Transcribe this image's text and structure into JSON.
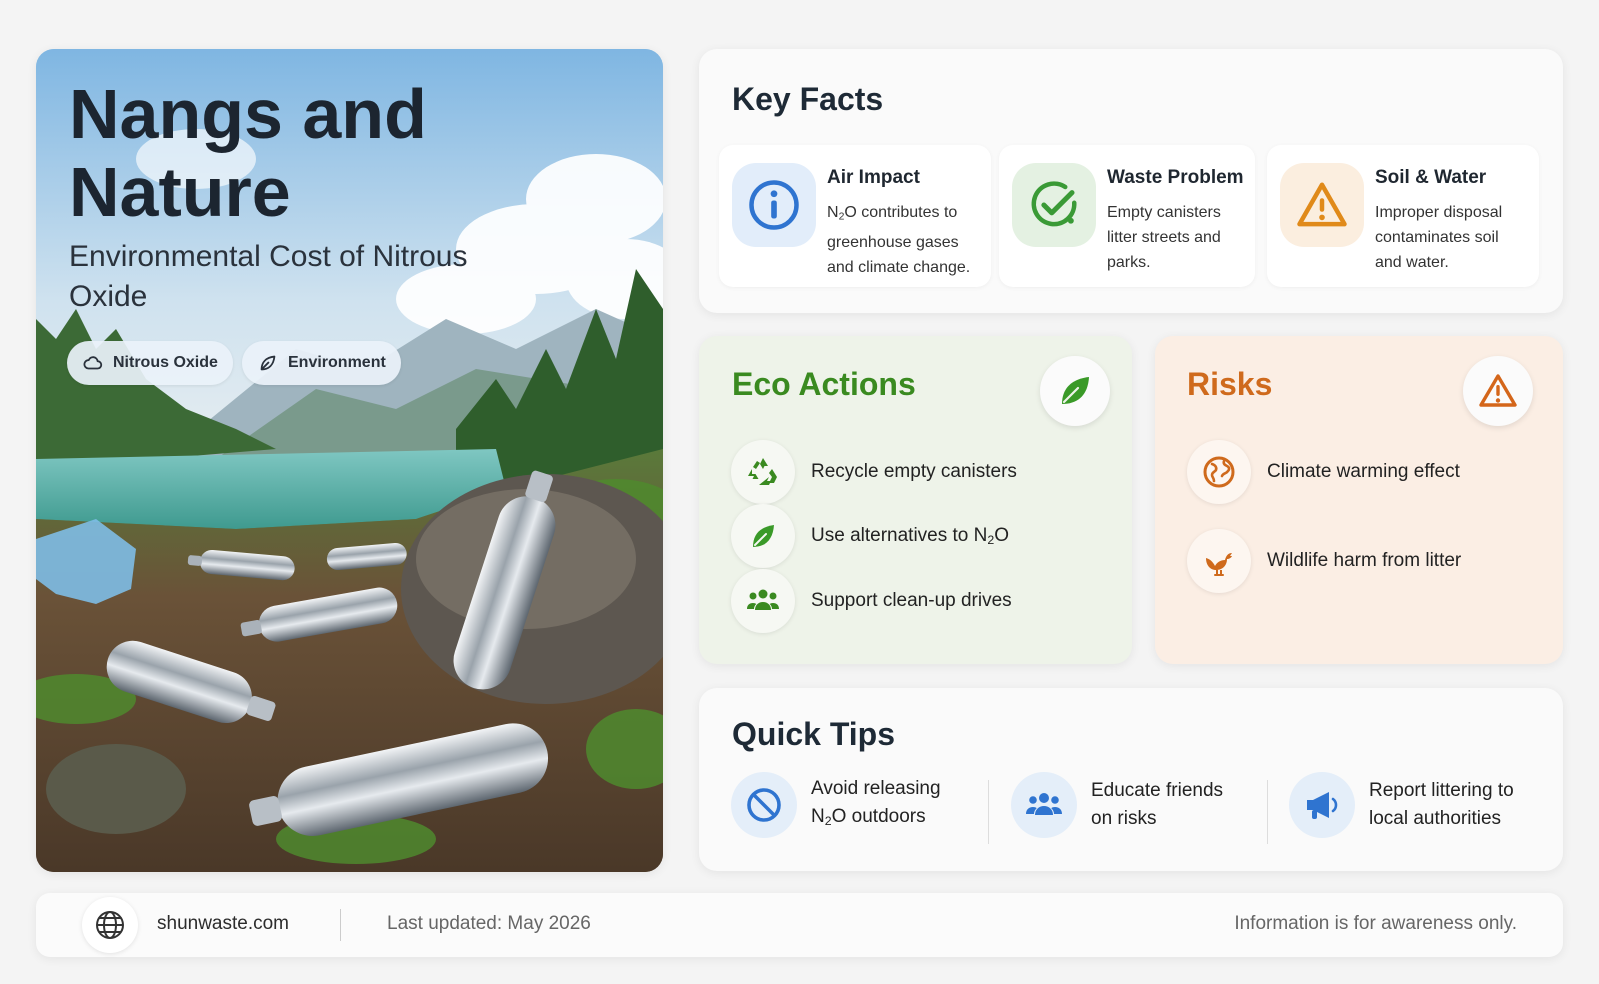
{
  "hero": {
    "title": "Nangs and Nature",
    "subtitle": "Environmental Cost of Nitrous Oxide",
    "tags": [
      {
        "label": "Nitrous Oxide",
        "icon": "cloud-icon"
      },
      {
        "label": "Environment",
        "icon": "leaf-icon"
      }
    ],
    "image": "lakeside-canisters-photo"
  },
  "key_facts": {
    "title": "Key Facts",
    "items": [
      {
        "title": "Air Impact",
        "text_pre": "N",
        "text_sub": "2",
        "text_post": "O contributes to greenhouse gases and climate change.",
        "icon": "info-icon",
        "color": "#2f74d0"
      },
      {
        "title": "Waste Problem",
        "text": "Empty canisters litter streets and parks.",
        "icon": "check-circle-icon",
        "color": "#3a9a36"
      },
      {
        "title": "Soil & Water",
        "text": "Improper disposal contaminates soil and water.",
        "icon": "warning-icon",
        "color": "#e08a1a"
      }
    ]
  },
  "eco_actions": {
    "title": "Eco Actions",
    "badge_icon": "leaf-icon",
    "color": "#3a8a20",
    "items": [
      {
        "text": "Recycle empty canisters",
        "icon": "recycle-icon"
      },
      {
        "text_pre": "Use alternatives to N",
        "text_sub": "2",
        "text_post": "O",
        "icon": "leaf-icon"
      },
      {
        "text": "Support clean-up drives",
        "icon": "people-icon"
      }
    ]
  },
  "risks": {
    "title": "Risks",
    "badge_icon": "warning-icon",
    "color": "#cf6a1c",
    "items": [
      {
        "text": "Climate warming effect",
        "icon": "globe-warming-icon"
      },
      {
        "text": "Wildlife harm from litter",
        "icon": "bird-icon"
      }
    ]
  },
  "quick_tips": {
    "title": "Quick Tips",
    "color": "#2f74d0",
    "items": [
      {
        "line1": "Avoid releasing",
        "line2_pre": "N",
        "line2_sub": "2",
        "line2_post": "O outdoors",
        "icon": "prohibited-icon"
      },
      {
        "line1": "Educate friends",
        "line2": "on risks",
        "icon": "group-icon"
      },
      {
        "line1": "Report littering to",
        "line2": "local authorities",
        "icon": "megaphone-icon"
      }
    ]
  },
  "footer": {
    "site": "shunwaste.com",
    "updated": "Last updated: May 2026",
    "disclaimer": "Information is for awareness only."
  }
}
